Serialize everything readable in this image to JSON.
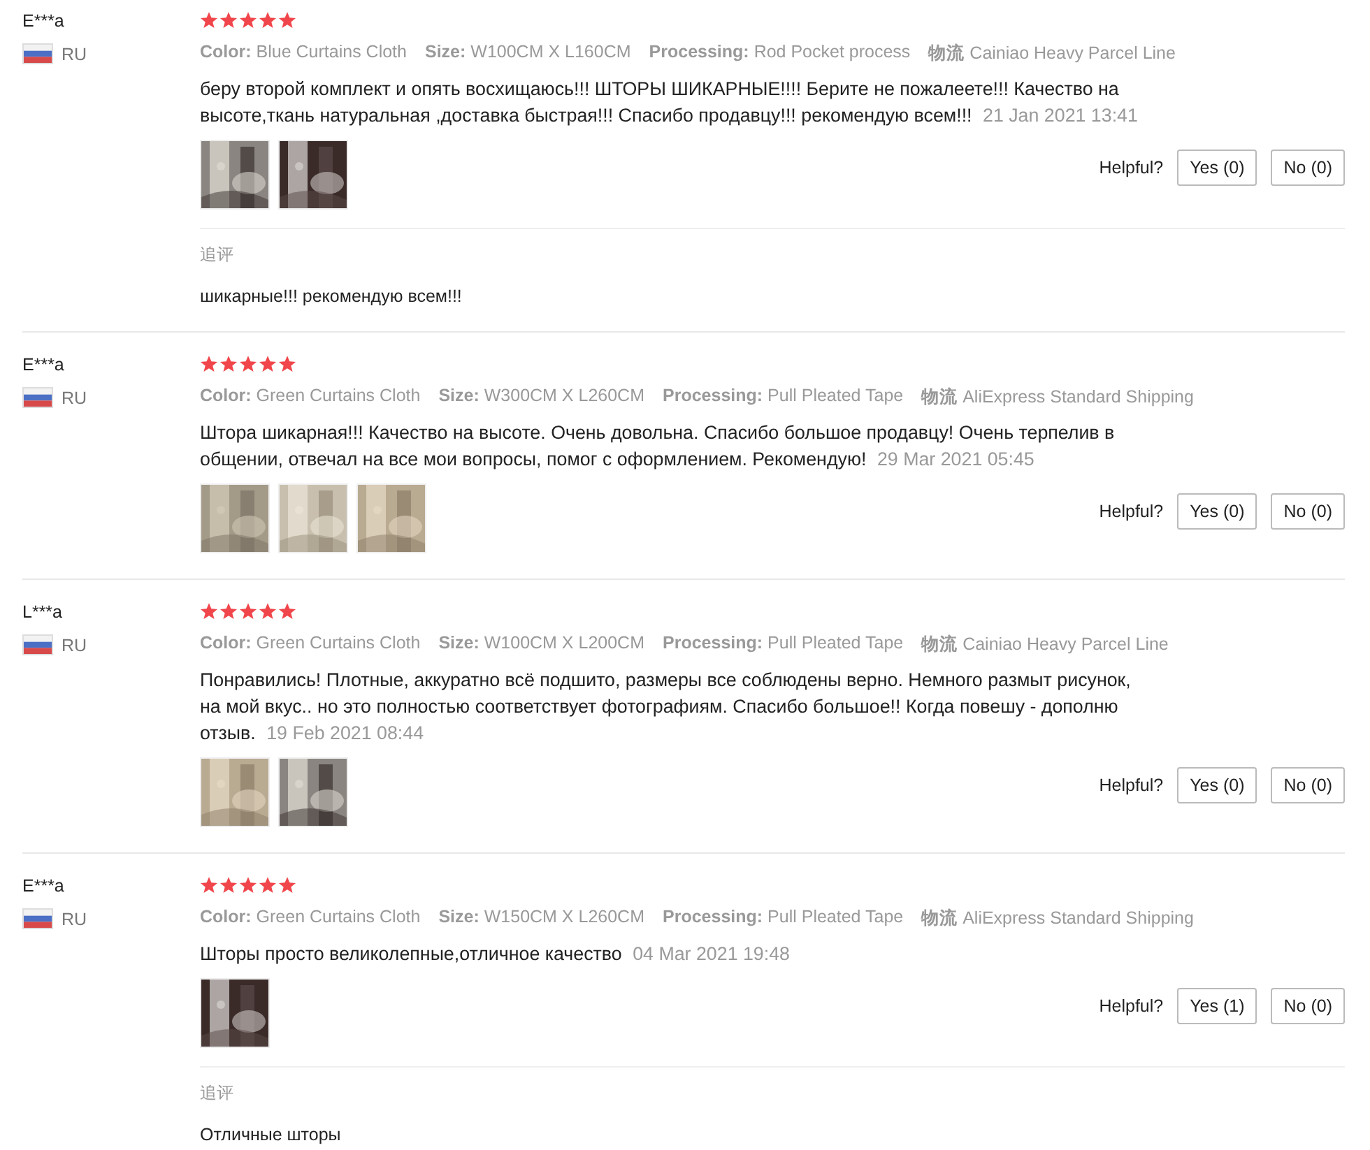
{
  "reviews": [
    {
      "user": "E***a",
      "country": "RU",
      "stars": 5,
      "attributes": [
        {
          "label": "Color:",
          "value": "Blue Curtains Cloth"
        },
        {
          "label": "Size:",
          "value": "W100CM X L160CM"
        },
        {
          "label": "Processing:",
          "value": "Rod Pocket process"
        },
        {
          "label": "物流",
          "value": "Cainiao Heavy Parcel Line"
        }
      ],
      "comment": "беру второй комплект и опять восхищаюсь!!! ШТОРЫ ШИКАРНЫЕ!!!! Берите не пожалеете!!! Качество на высоте,ткань натуральная ,доставка быстрая!!! Спасибо продавцу!!! рекомендую всем!!!",
      "date": "21 Jan 2021 13:41",
      "photos": [
        {
          "kind": "picture"
        },
        {
          "kind": "picture"
        }
      ],
      "helpful_label": "Helpful?",
      "yes": "Yes (0)",
      "no": "No (0)",
      "followup": {
        "label": "追评",
        "text": "шикарные!!! рекомендую всем!!!"
      }
    },
    {
      "user": "E***a",
      "country": "RU",
      "stars": 5,
      "attributes": [
        {
          "label": "Color:",
          "value": "Green Curtains Cloth"
        },
        {
          "label": "Size:",
          "value": "W300CM X L260CM"
        },
        {
          "label": "Processing:",
          "value": "Pull Pleated Tape"
        },
        {
          "label": "物流",
          "value": "AliExpress Standard Shipping"
        }
      ],
      "comment": "Штора шикарная!!! Качество на высоте. Очень довольна. Спасибо большое продавцу! Очень терпелив в общении, отвечал на все мои вопросы, помог с оформлением. Рекомендую!",
      "date": "29 Mar 2021 05:45",
      "photos": [
        {
          "kind": "picture"
        },
        {
          "kind": "picture"
        },
        {
          "kind": "picture"
        }
      ],
      "helpful_label": "Helpful?",
      "yes": "Yes (0)",
      "no": "No (0)"
    },
    {
      "user": "L***a",
      "country": "RU",
      "stars": 5,
      "attributes": [
        {
          "label": "Color:",
          "value": "Green Curtains Cloth"
        },
        {
          "label": "Size:",
          "value": "W100CM X L200CM"
        },
        {
          "label": "Processing:",
          "value": "Pull Pleated Tape"
        },
        {
          "label": "物流",
          "value": "Cainiao Heavy Parcel Line"
        }
      ],
      "comment": "Понравились! Плотные, аккуратно всё подшито, размеры все соблюдены верно. Немного размыт рисунок, на мой вкус.. но это полностью соответствует фотографиям. Спасибо большое!! Когда повешу - дополню отзыв.",
      "date": "19 Feb 2021 08:44",
      "photos": [
        {
          "kind": "picture"
        },
        {
          "kind": "picture"
        }
      ],
      "helpful_label": "Helpful?",
      "yes": "Yes (0)",
      "no": "No (0)"
    },
    {
      "user": "E***a",
      "country": "RU",
      "stars": 5,
      "attributes": [
        {
          "label": "Color:",
          "value": "Green Curtains Cloth"
        },
        {
          "label": "Size:",
          "value": "W150CM X L260CM"
        },
        {
          "label": "Processing:",
          "value": "Pull Pleated Tape"
        },
        {
          "label": "物流",
          "value": "AliExpress Standard Shipping"
        }
      ],
      "comment": "Шторы просто великолепные,отличное качество",
      "date": "04 Mar 2021 19:48",
      "photos": [
        {
          "kind": "picture"
        }
      ],
      "helpful_label": "Helpful?",
      "yes": "Yes (1)",
      "no": "No (0)",
      "followup": {
        "label": "追评",
        "text": "Отличные шторы"
      }
    }
  ]
}
